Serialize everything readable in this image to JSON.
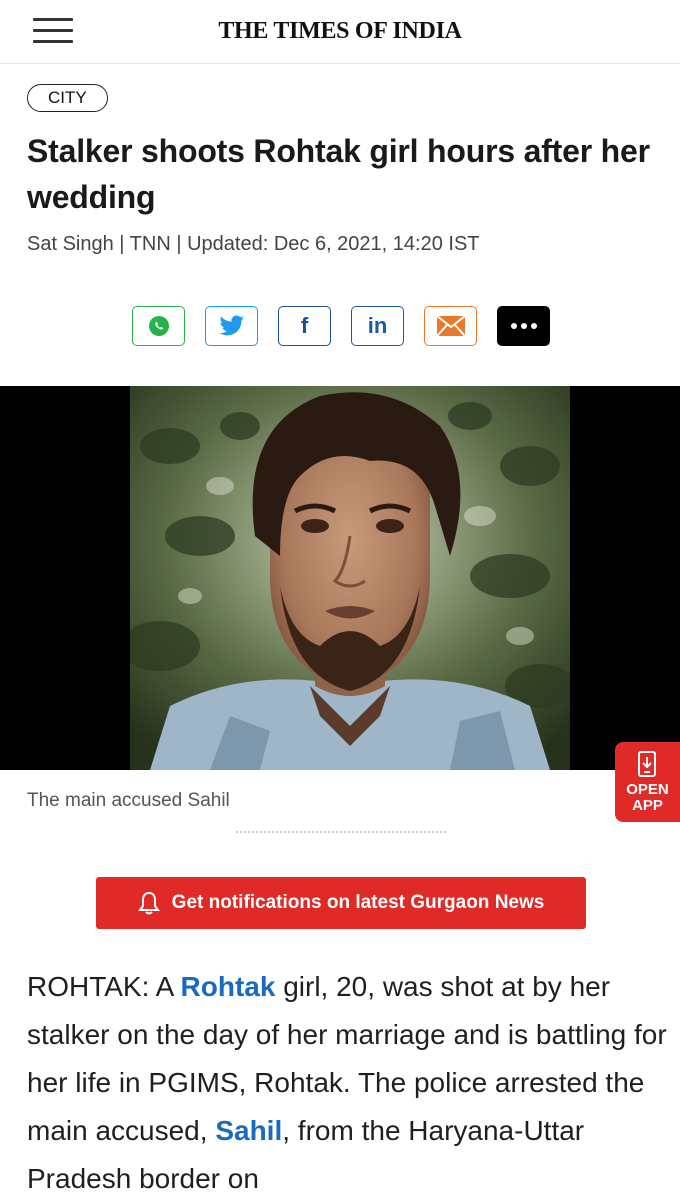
{
  "header": {
    "brand": "THE TIMES OF INDIA",
    "menu_icon": "hamburger-menu-icon"
  },
  "article": {
    "section": "CITY",
    "headline": "Stalker shoots Rohtak girl hours after her wedding",
    "byline": "Sat Singh | TNN | Updated: Dec 6, 2021, 14:20 IST",
    "image_caption": "The main accused Sahil",
    "body": {
      "p1_a": "ROHTAK: A ",
      "p1_link1": "Rohtak",
      "p1_b": " girl, 20, was shot at by her stalker on the day of her marriage and is battling for her life in PGIMS, Rohtak. The police arrested the main accused, ",
      "p1_link2": "Sahil",
      "p1_c": ", from the Haryana-Uttar Pradesh border on"
    }
  },
  "share": {
    "icons": [
      "whatsapp-icon",
      "twitter-icon",
      "facebook-icon",
      "linkedin-icon",
      "email-icon",
      "more-icon"
    ],
    "fb_glyph": "f",
    "li_glyph": "in",
    "colors": {
      "whatsapp": "#25b34a",
      "twitter": "#1d9bf0",
      "facebook": "#1b4f9c",
      "linkedin": "#1a5ba8",
      "email": "#e8792a",
      "more": "#000000"
    }
  },
  "open_app": {
    "label_line1": "OPEN",
    "label_line2": "APP"
  },
  "notify": {
    "label": "Get notifications on latest Gurgaon News"
  },
  "theme": {
    "accent_red": "#e02a27",
    "link_blue": "#1a6bbf"
  }
}
